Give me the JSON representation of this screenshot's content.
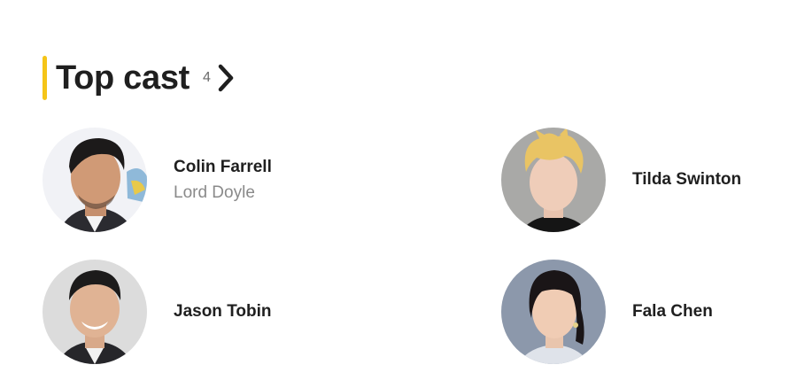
{
  "section": {
    "title": "Top cast",
    "count": "4",
    "accent_color": "#f5c518",
    "chevron_icon": "chevron-right-icon"
  },
  "cast": [
    {
      "name": "Colin Farrell",
      "role": "Lord Doyle",
      "avatar": "headshot-colin-farrell"
    },
    {
      "name": "Tilda Swinton",
      "role": "",
      "avatar": "headshot-tilda-swinton"
    },
    {
      "name": "Jason Tobin",
      "role": "",
      "avatar": "headshot-jason-tobin"
    },
    {
      "name": "Fala Chen",
      "role": "",
      "avatar": "headshot-fala-chen"
    }
  ]
}
